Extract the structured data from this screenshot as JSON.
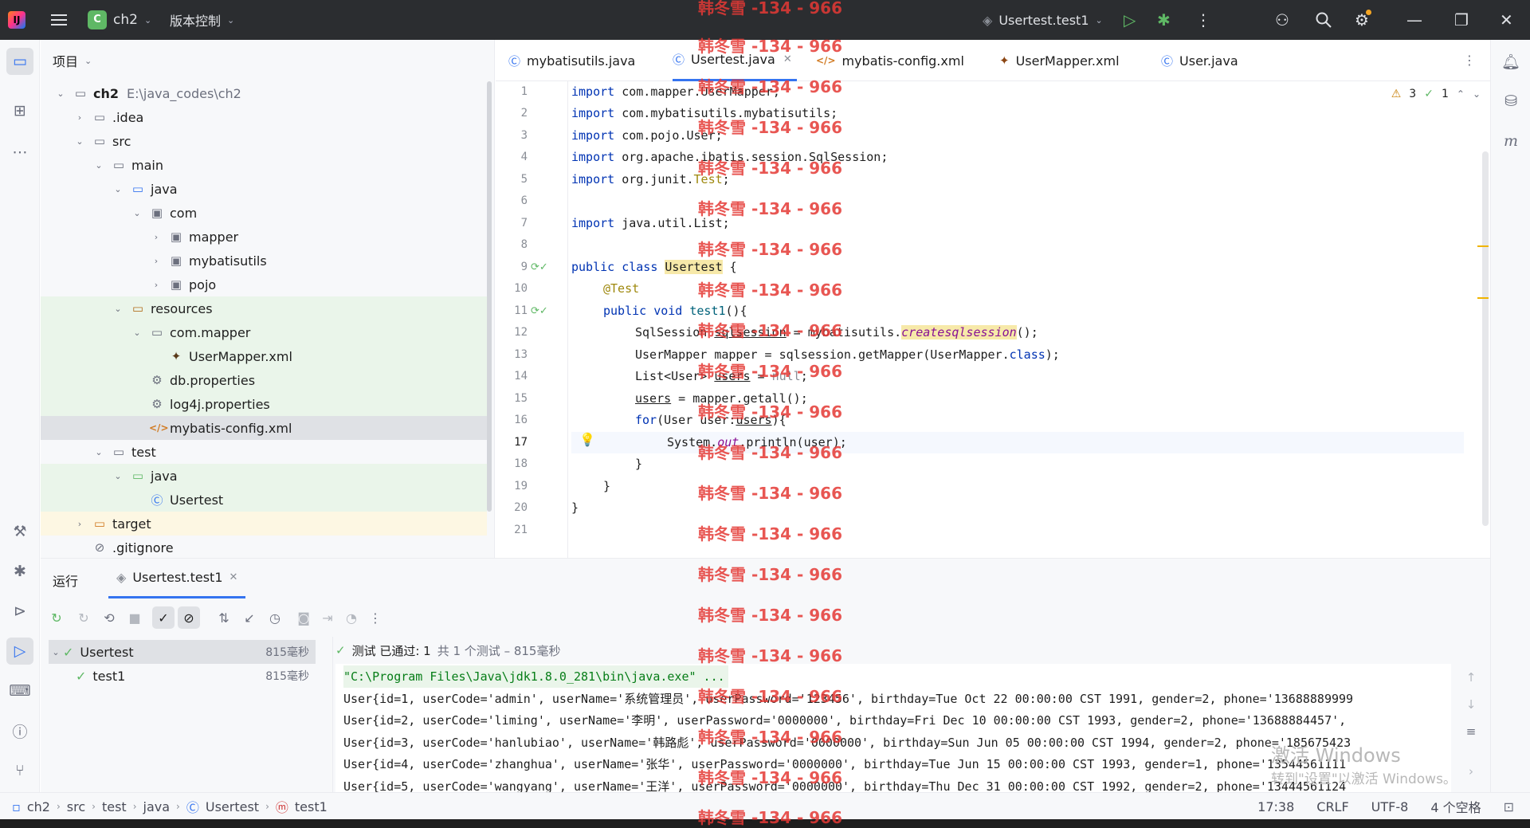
{
  "titlebar": {
    "project_letter": "C",
    "project_name": "ch2",
    "vcs_label": "版本控制",
    "run_config": "Usertest.test1"
  },
  "project_panel": {
    "title": "项目",
    "tree": [
      {
        "label": "ch2",
        "path": "E:\\java_codes\\ch2"
      },
      {
        "label": ".idea"
      },
      {
        "label": "src"
      },
      {
        "label": "main"
      },
      {
        "label": "java"
      },
      {
        "label": "com"
      },
      {
        "label": "mapper"
      },
      {
        "label": "mybatisutils"
      },
      {
        "label": "pojo"
      },
      {
        "label": "resources"
      },
      {
        "label": "com.mapper"
      },
      {
        "label": "UserMapper.xml"
      },
      {
        "label": "db.properties"
      },
      {
        "label": "log4j.properties"
      },
      {
        "label": "mybatis-config.xml"
      },
      {
        "label": "test"
      },
      {
        "label": "java"
      },
      {
        "label": "Usertest"
      },
      {
        "label": "target"
      },
      {
        "label": ".gitignore"
      }
    ]
  },
  "editor": {
    "tabs": [
      {
        "label": "mybatisutils.java"
      },
      {
        "label": "Usertest.java"
      },
      {
        "label": "mybatis-config.xml"
      },
      {
        "label": "UserMapper.xml"
      },
      {
        "label": "User.java"
      }
    ],
    "line_numbers": [
      "1",
      "2",
      "3",
      "4",
      "5",
      "6",
      "7",
      "8",
      "9",
      "10",
      "11",
      "12",
      "13",
      "14",
      "15",
      "16",
      "17",
      "18",
      "19",
      "20",
      "21"
    ],
    "code": {
      "l1": {
        "kw": "import",
        "rest": " com.mapper.UserMapper;"
      },
      "l2": {
        "kw": "import",
        "rest": " com.mybatisutils.mybatisutils;"
      },
      "l3": {
        "kw": "import",
        "rest": " com.pojo.User;"
      },
      "l4": {
        "kw": "import",
        "rest": " org.apache.ibatis.session.SqlSession;"
      },
      "l5": {
        "kw": "import",
        "rest": " org.junit.",
        "ann": "Test",
        "end": ";"
      },
      "l7": {
        "kw": "import",
        "rest": " java.util.List;"
      },
      "l9": {
        "kw": "public class",
        "cls": "Usertest",
        "end": " {"
      },
      "l10": {
        "ann": "@Test"
      },
      "l11": {
        "kw": "public void",
        "fn": "test1",
        "end": "(){"
      },
      "l12": {
        "a": "SqlSession ",
        "b": "sqlsession",
        "c": " = mybatisutils.",
        "st": "createsqlsession",
        "d": "();"
      },
      "l13": {
        "a": "UserMapper mapper = sqlsession.getMapper(UserMapper.",
        "kw": "class",
        "b": ");"
      },
      "l14": {
        "a": "List<User> ",
        "b": "users",
        "c": " = ",
        "nl": "null",
        "d": ";"
      },
      "l15": {
        "a": "users",
        "b": " = mapper.getall();"
      },
      "l16": {
        "kw": "for",
        "a": "(User user:",
        "b": "users",
        "c": "){"
      },
      "l17": {
        "a": "System.",
        "st": "out",
        "b": ".println(user);"
      },
      "l18": {
        "a": "}"
      },
      "l19": {
        "a": "}"
      },
      "l20": {
        "a": "}"
      }
    },
    "inspection": {
      "warnings": "3",
      "ok": "1"
    }
  },
  "run_panel": {
    "title": "运行",
    "tab": "Usertest.test1",
    "tests": [
      {
        "name": "Usertest",
        "duration": "815毫秒"
      },
      {
        "name": "test1",
        "duration": "815毫秒"
      }
    ],
    "summary_main": "测试 已通过: 1",
    "summary_sub": "共 1 个测试 – 815毫秒",
    "console": [
      "\"C:\\Program Files\\Java\\jdk1.8.0_281\\bin\\java.exe\" ...",
      "User{id=1, userCode='admin', userName='系统管理员', userPassword='123456', birthday=Tue Oct 22 00:00:00 CST 1991, gender=2, phone='13688889999",
      "User{id=2, userCode='liming', userName='李明', userPassword='0000000', birthday=Fri Dec 10 00:00:00 CST 1993, gender=2, phone='13688884457',",
      "User{id=3, userCode='hanlubiao', userName='韩路彪', userPassword='0000000', birthday=Sun Jun 05 00:00:00 CST 1994, gender=2, phone='185675423",
      "User{id=4, userCode='zhanghua', userName='张华', userPassword='0000000', birthday=Tue Jun 15 00:00:00 CST 1993, gender=1, phone='13544561111",
      "User{id=5, userCode='wangyang', userName='王洋', userPassword='0000000', birthday=Thu Dec 31 00:00:00 CST 1992, gender=2, phone='13444561124"
    ]
  },
  "statusbar": {
    "crumbs": [
      "ch2",
      "src",
      "test",
      "java",
      "Usertest",
      "test1"
    ],
    "position": "17:38",
    "line_sep": "CRLF",
    "encoding": "UTF-8",
    "indent": "4 个空格"
  },
  "watermark": "韩冬雪 -134 - 966",
  "activation": {
    "line1": "激活 Windows",
    "line2": "转到\"设置\"以激活 Windows。"
  }
}
